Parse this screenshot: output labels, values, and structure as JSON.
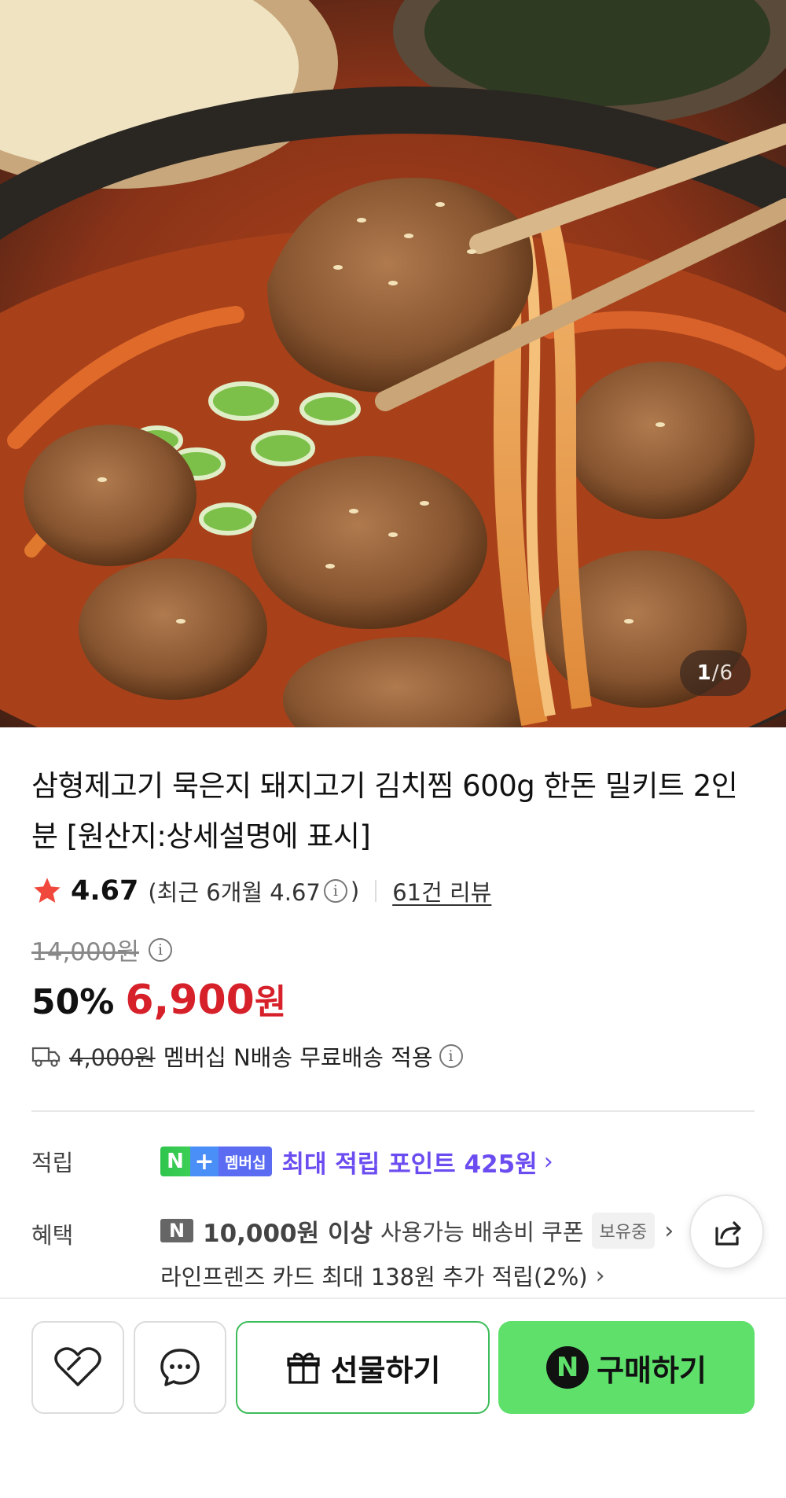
{
  "gallery": {
    "current": "1",
    "separator": "/",
    "total": "6"
  },
  "product": {
    "title": "삼형제고기 묵은지 돼지고기 김치찜 600g 한돈 밀키트 2인분 [원산지:상세설명에 표시]",
    "rating": "4.67",
    "rating_recent": "(최근 6개월 4.67",
    "rating_recent_close": ")",
    "reviews": "61건 리뷰",
    "original_price": "14,000원",
    "discount": "50%",
    "price": "6,900",
    "price_unit": "원",
    "shipping_original": "4,000원",
    "shipping_text": "멤버십 N배송 무료배송 적용"
  },
  "points": {
    "label": "적립",
    "badge_n": "N",
    "badge_plus": "+",
    "badge_member": "멤버십",
    "text": "최대 적립 포인트 425원"
  },
  "benefits": {
    "label": "혜택",
    "logo": "N",
    "coupon_strong": "10,000원 이상",
    "coupon_text": "사용가능 배송비 쿠폰",
    "owned": "보유중",
    "card_text": "라인프렌즈 카드 최대 138원 추가 적립(2%)"
  },
  "actions": {
    "gift": "선물하기",
    "buy": "구매하기",
    "buy_logo": "N"
  },
  "icons": {
    "star": "star-icon",
    "info": "info-icon",
    "truck": "truck-icon",
    "share": "share-icon",
    "heart": "heart-icon",
    "chat": "chat-bubble-icon",
    "gift": "gift-icon"
  },
  "colors": {
    "price_red": "#d6202a",
    "point_purple": "#6b4cf0",
    "buy_green": "#5ee06b",
    "star": "#f0483c"
  }
}
